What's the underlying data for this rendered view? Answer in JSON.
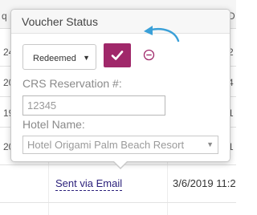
{
  "table": {
    "header_left": "q",
    "header_right": "D",
    "row_nums": [
      "24",
      "20",
      "19",
      "20"
    ],
    "row_right": [
      "2",
      "4",
      "1",
      "1"
    ],
    "sent_link": "Sent via Email",
    "date": "3/6/2019 11:2"
  },
  "popover": {
    "title": "Voucher Status",
    "status_select": {
      "value": "Redeemed",
      "caret": "▼"
    },
    "confirm_icon": "check-icon",
    "cancel_icon": "minus-circle-icon",
    "hint_icon": "curved-arrow-icon",
    "crs_label": "CRS Reservation #:",
    "crs_input": {
      "value": "12345"
    },
    "hotel_label": "Hotel Name:",
    "hotel_select": {
      "value": "Hotel Origami Palm Beach Resort",
      "caret": "▼"
    }
  },
  "colors": {
    "accent": "#a0286a",
    "hint_arrow": "#3aa0d8",
    "link": "#2a1f7a"
  }
}
